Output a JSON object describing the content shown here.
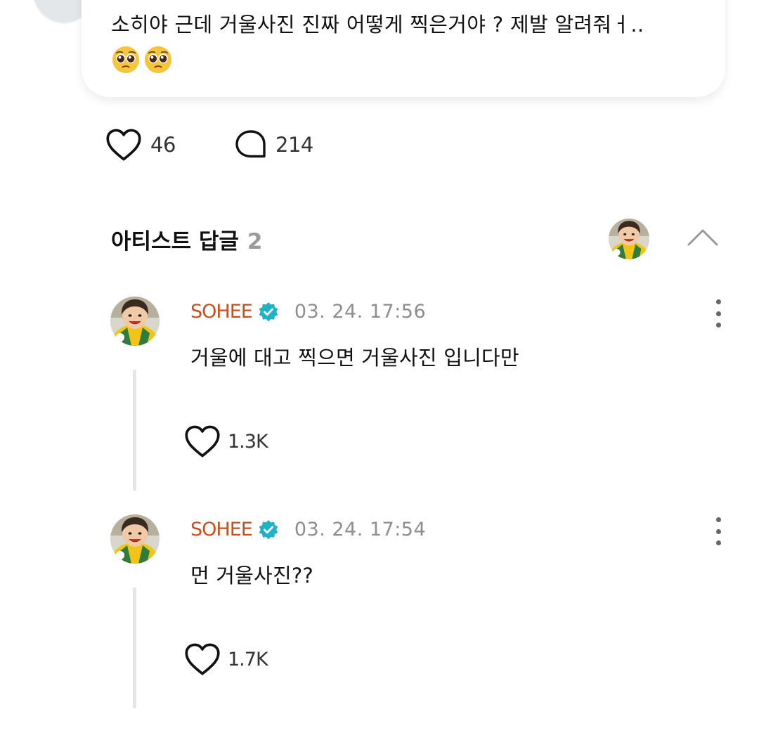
{
  "post": {
    "text": "소히야 근데 거울사진 진짜 어떻게 찍은거야 ? 제발 알려줘ㅓ..",
    "emojis": [
      "pleading-face",
      "pleading-face"
    ],
    "likes": "46",
    "comments": "214"
  },
  "artist_replies": {
    "title": "아티스트 답글",
    "count": "2",
    "replies": [
      {
        "name": "SOHEE",
        "time": "03. 24. 17:56",
        "text": "거울에 대고 찍으면 거울사진 입니다만",
        "likes": "1.3K"
      },
      {
        "name": "SOHEE",
        "time": "03. 24. 17:54",
        "text": "먼 거울사진??",
        "likes": "1.7K"
      }
    ]
  },
  "colors": {
    "artist_name": "#c8501f",
    "verified_badge": "#1fb2c6",
    "muted_text": "#8e8e8e"
  }
}
